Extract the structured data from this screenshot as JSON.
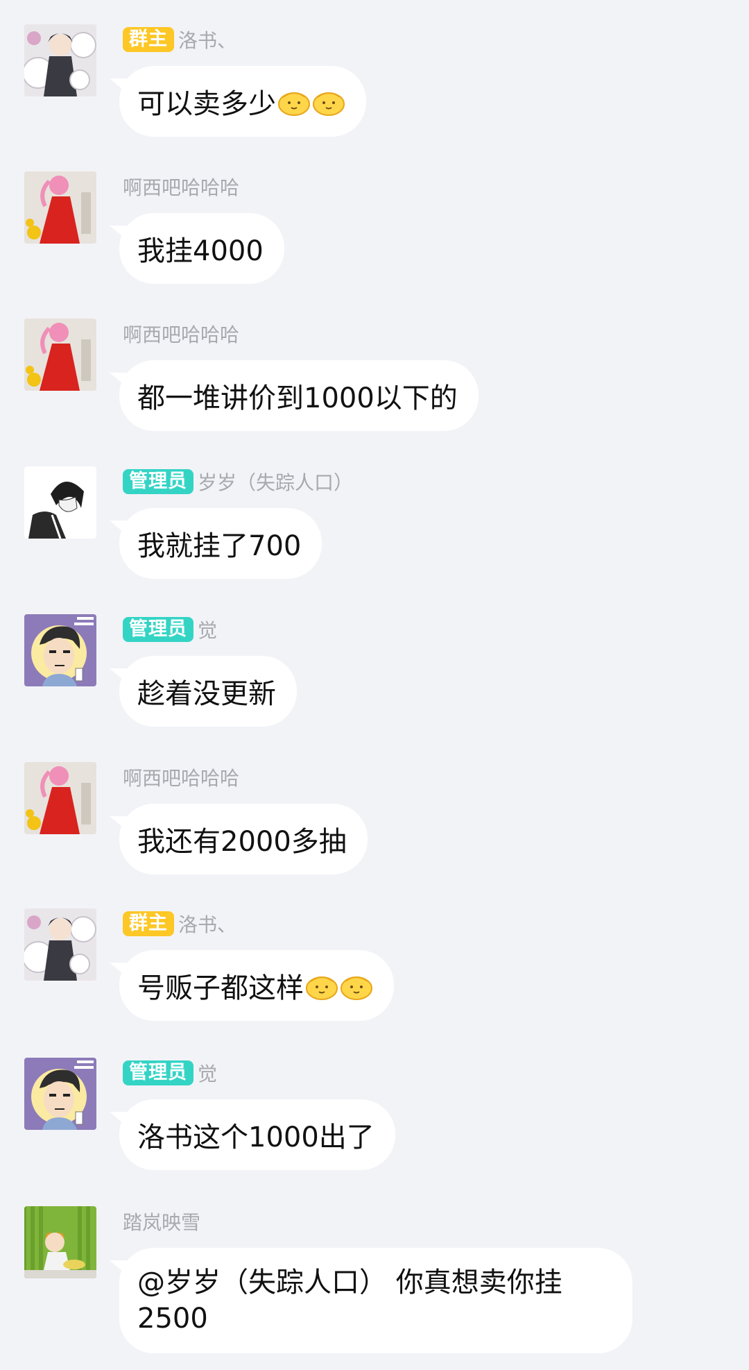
{
  "messages": [
    {
      "badge": "群主",
      "badge_type": "owner",
      "name": "洛书、",
      "text": "可以卖多少",
      "emojis": 2,
      "avatar": "anime-group-avatar-icon"
    },
    {
      "badge": "",
      "badge_type": "",
      "name": "啊西吧哈哈哈",
      "text": "我挂4000",
      "emojis": 0,
      "avatar": "red-dress-girl-avatar-icon"
    },
    {
      "badge": "",
      "badge_type": "",
      "name": "啊西吧哈哈哈",
      "text": "都一堆讲价到1000以下的",
      "emojis": 0,
      "avatar": "red-dress-girl-avatar-icon"
    },
    {
      "badge": "管理员",
      "badge_type": "admin",
      "name": "岁岁（失踪人口）",
      "text": "我就挂了700",
      "emojis": 0,
      "avatar": "sketch-boy-avatar-icon"
    },
    {
      "badge": "管理员",
      "badge_type": "admin",
      "name": "觉",
      "text": "趁着没更新",
      "emojis": 0,
      "avatar": "cartoon-man-avatar-icon"
    },
    {
      "badge": "",
      "badge_type": "",
      "name": "啊西吧哈哈哈",
      "text": "我还有2000多抽",
      "emojis": 0,
      "avatar": "red-dress-girl-avatar-icon"
    },
    {
      "badge": "群主",
      "badge_type": "owner",
      "name": "洛书、",
      "text": "号贩子都这样",
      "emojis": 2,
      "avatar": "anime-group-avatar-icon"
    },
    {
      "badge": "管理员",
      "badge_type": "admin",
      "name": "觉",
      "text": "洛书这个1000出了",
      "emojis": 0,
      "avatar": "cartoon-man-avatar-icon"
    },
    {
      "badge": "",
      "badge_type": "",
      "name": "踏岚映雪",
      "text": "@岁岁（失踪人口） 你真想卖你挂2500",
      "emojis": 0,
      "avatar": "green-curtain-avatar-icon"
    }
  ],
  "colors": {
    "background": "#f2f3f7",
    "bubble": "#ffffff",
    "owner_badge": "#fdc726",
    "admin_badge": "#34d4c5",
    "name": "#a7a9ae"
  }
}
